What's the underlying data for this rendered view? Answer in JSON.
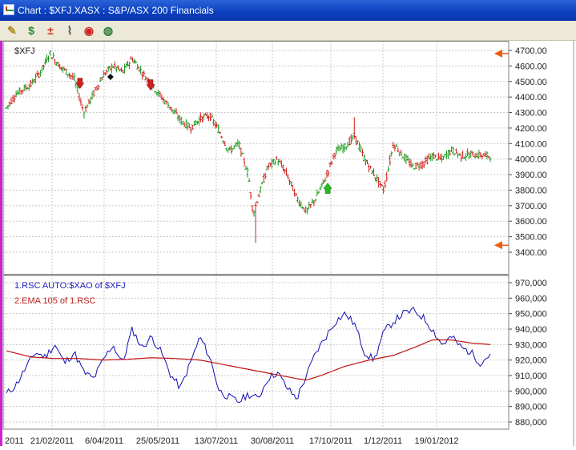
{
  "window": {
    "title": "Chart : $XFJ.XASX : S&P/ASX 200 Financials"
  },
  "toolbar": {
    "buttons": [
      {
        "name": "notes-button",
        "icon": "notepad-icon",
        "glyph": "✎",
        "color": "#b08a20"
      },
      {
        "name": "dollar-button",
        "icon": "dollar-icon",
        "glyph": "$",
        "color": "#1f8a2a"
      },
      {
        "name": "calculator-button",
        "icon": "math-operators-icon",
        "glyph": "±",
        "color": "#d03020"
      },
      {
        "name": "attach-button",
        "icon": "paperclip-icon",
        "glyph": "⌇",
        "color": "#505060"
      },
      {
        "name": "broadcast-button",
        "icon": "broadcast-icon",
        "glyph": "◉",
        "color": "#d02020"
      },
      {
        "name": "web-button",
        "icon": "globe-icon",
        "glyph": "◍",
        "color": "#2a7a3a"
      }
    ]
  },
  "price_pane": {
    "label": "$XFJ",
    "y_ticks": [
      "4700.00",
      "4600.00",
      "4500.00",
      "4400.00",
      "4300.00",
      "4200.00",
      "4100.00",
      "4000.00",
      "3900.00",
      "3800.00",
      "3700.00",
      "3600.00",
      "3500.00",
      "3400.00"
    ],
    "marker_levels": [
      4680,
      3445
    ],
    "marker_color": "#f05a10"
  },
  "indicator_pane": {
    "legend_1": "1.RSC  AUTO:$XAO of $XFJ",
    "legend_2": "2.EMA 105  of 1.RSC",
    "legend_1_color": "#2020c0",
    "legend_2_color": "#c02020",
    "y_ticks": [
      "970,000",
      "960,000",
      "950,000",
      "940,000",
      "930,000",
      "920,000",
      "910,000",
      "900,000",
      "890,000",
      "880,000"
    ]
  },
  "x_ticks": [
    "2011",
    "21/02/2011",
    "6/04/2011",
    "25/05/2011",
    "13/07/2011",
    "30/08/2011",
    "17/10/2011",
    "1/12/2011",
    "19/01/2012"
  ],
  "chart_data": [
    {
      "type": "candlestick",
      "label": "$XFJ",
      "ylim": [
        3400,
        4700
      ],
      "up_color": "#1a9a1a",
      "down_color": "#d02020",
      "path": [
        [
          0,
          4330
        ],
        [
          0.02,
          4420
        ],
        [
          0.05,
          4480
        ],
        [
          0.07,
          4560
        ],
        [
          0.09,
          4680
        ],
        [
          0.11,
          4600
        ],
        [
          0.14,
          4520
        ],
        [
          0.16,
          4300
        ],
        [
          0.18,
          4420
        ],
        [
          0.2,
          4540
        ],
        [
          0.22,
          4600
        ],
        [
          0.24,
          4560
        ],
        [
          0.26,
          4650
        ],
        [
          0.28,
          4560
        ],
        [
          0.3,
          4480
        ],
        [
          0.32,
          4400
        ],
        [
          0.34,
          4330
        ],
        [
          0.36,
          4250
        ],
        [
          0.38,
          4200
        ],
        [
          0.4,
          4260
        ],
        [
          0.42,
          4280
        ],
        [
          0.44,
          4180
        ],
        [
          0.46,
          4050
        ],
        [
          0.48,
          4100
        ],
        [
          0.5,
          3900
        ],
        [
          0.51,
          3650
        ],
        [
          0.52,
          3750
        ],
        [
          0.54,
          3950
        ],
        [
          0.56,
          4000
        ],
        [
          0.58,
          3900
        ],
        [
          0.6,
          3750
        ],
        [
          0.62,
          3660
        ],
        [
          0.64,
          3750
        ],
        [
          0.66,
          3880
        ],
        [
          0.68,
          4050
        ],
        [
          0.7,
          4080
        ],
        [
          0.72,
          4150
        ],
        [
          0.74,
          4000
        ],
        [
          0.76,
          3900
        ],
        [
          0.78,
          3800
        ],
        [
          0.8,
          4100
        ],
        [
          0.82,
          4020
        ],
        [
          0.84,
          3950
        ],
        [
          0.86,
          3970
        ],
        [
          0.88,
          4020
        ],
        [
          0.9,
          4000
        ],
        [
          0.92,
          4060
        ],
        [
          0.94,
          4020
        ],
        [
          0.96,
          4030
        ],
        [
          1,
          4020
        ]
      ],
      "spikes": [
        {
          "x": 0.515,
          "low": 3460
        },
        {
          "x": 0.718,
          "high": 4270
        }
      ],
      "signals": [
        {
          "type": "sell",
          "x": 0.152,
          "price": 4480,
          "color": "#d02020"
        },
        {
          "type": "diamond",
          "x": 0.215,
          "price": 4530,
          "color": "#111111"
        },
        {
          "type": "sell",
          "x": 0.298,
          "price": 4470,
          "color": "#d02020"
        },
        {
          "type": "buy",
          "x": 0.664,
          "price": 3820,
          "color": "#20c020"
        }
      ]
    },
    {
      "type": "line",
      "ylim": [
        870000,
        970000
      ],
      "series": [
        {
          "name": "1.RSC  AUTO:$XAO of $XFJ",
          "color": "#1010b0",
          "path": [
            [
              0,
              898000
            ],
            [
              0.02,
              904000
            ],
            [
              0.04,
              915000
            ],
            [
              0.06,
              925000
            ],
            [
              0.08,
              922000
            ],
            [
              0.1,
              930000
            ],
            [
              0.12,
              918000
            ],
            [
              0.14,
              925000
            ],
            [
              0.16,
              912000
            ],
            [
              0.18,
              908000
            ],
            [
              0.2,
              920000
            ],
            [
              0.22,
              930000
            ],
            [
              0.24,
              918000
            ],
            [
              0.26,
              940000
            ],
            [
              0.28,
              928000
            ],
            [
              0.3,
              935000
            ],
            [
              0.32,
              925000
            ],
            [
              0.34,
              910000
            ],
            [
              0.36,
              902000
            ],
            [
              0.38,
              918000
            ],
            [
              0.4,
              935000
            ],
            [
              0.42,
              922000
            ],
            [
              0.44,
              900000
            ],
            [
              0.46,
              896000
            ],
            [
              0.48,
              893000
            ],
            [
              0.5,
              898000
            ],
            [
              0.52,
              895000
            ],
            [
              0.54,
              908000
            ],
            [
              0.56,
              912000
            ],
            [
              0.58,
              902000
            ],
            [
              0.6,
              895000
            ],
            [
              0.62,
              910000
            ],
            [
              0.64,
              925000
            ],
            [
              0.66,
              935000
            ],
            [
              0.68,
              945000
            ],
            [
              0.7,
              950000
            ],
            [
              0.72,
              943000
            ],
            [
              0.74,
              925000
            ],
            [
              0.76,
              920000
            ],
            [
              0.78,
              938000
            ],
            [
              0.8,
              945000
            ],
            [
              0.82,
              950000
            ],
            [
              0.84,
              952000
            ],
            [
              0.86,
              948000
            ],
            [
              0.88,
              940000
            ],
            [
              0.9,
              930000
            ],
            [
              0.92,
              935000
            ],
            [
              0.94,
              928000
            ],
            [
              0.96,
              925000
            ],
            [
              0.98,
              918000
            ],
            [
              1,
              924000
            ]
          ]
        },
        {
          "name": "2.EMA 105  of 1.RSC",
          "color": "#c01010",
          "path": [
            [
              0,
              926000
            ],
            [
              0.05,
              922000
            ],
            [
              0.1,
              921000
            ],
            [
              0.15,
              921000
            ],
            [
              0.2,
              920000
            ],
            [
              0.25,
              920500
            ],
            [
              0.3,
              921500
            ],
            [
              0.35,
              921000
            ],
            [
              0.4,
              920000
            ],
            [
              0.45,
              917000
            ],
            [
              0.5,
              914000
            ],
            [
              0.55,
              911000
            ],
            [
              0.6,
              908000
            ],
            [
              0.62,
              907000
            ],
            [
              0.65,
              910000
            ],
            [
              0.7,
              916000
            ],
            [
              0.75,
              920000
            ],
            [
              0.8,
              923000
            ],
            [
              0.85,
              929000
            ],
            [
              0.88,
              933000
            ],
            [
              0.92,
              933000
            ],
            [
              0.96,
              931000
            ],
            [
              1,
              930000
            ]
          ]
        }
      ]
    }
  ]
}
